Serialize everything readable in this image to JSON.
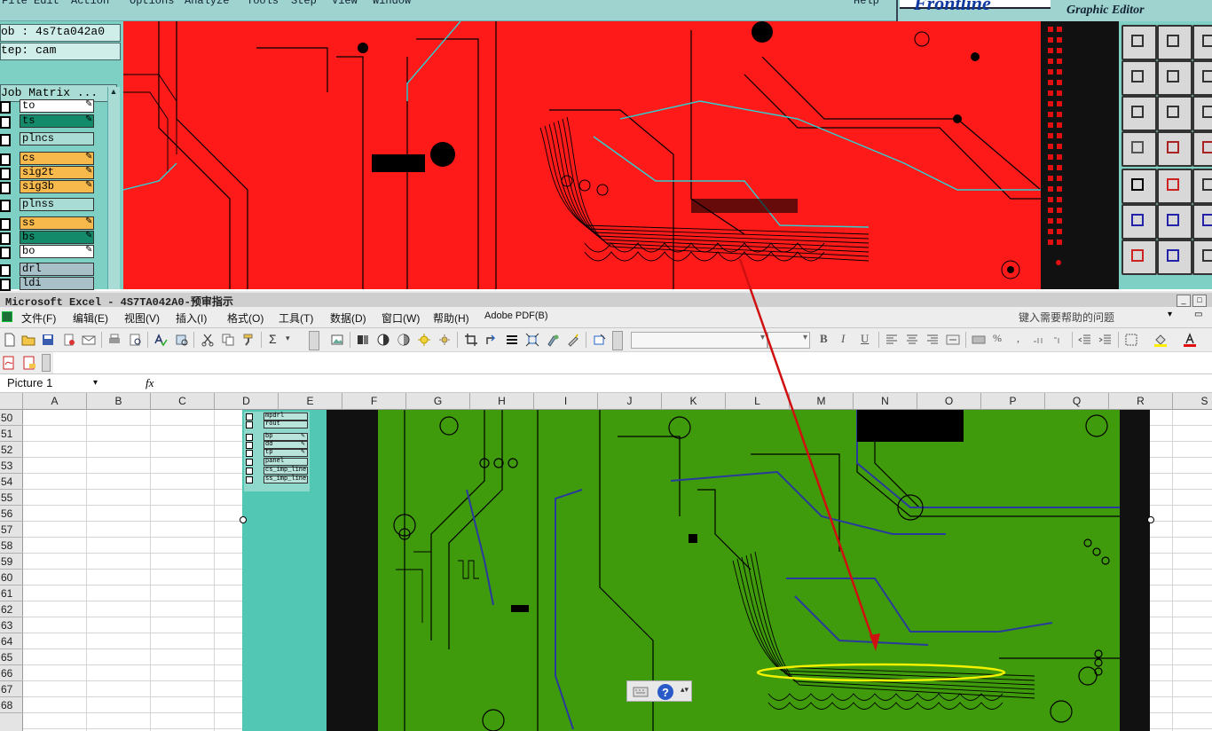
{
  "frontline": {
    "menu": [
      "File",
      "Edit",
      "Action",
      "Options",
      "Analyze",
      "Tools",
      "Step",
      "View",
      "Window",
      "Help"
    ],
    "logo": "Frontline",
    "subtitle": "Graphic Editor",
    "job": "ob : 4s7ta042a0",
    "step": "tep: cam",
    "matrix_button": "Job Matrix ...",
    "layers": [
      {
        "name": "to",
        "color": "#ffffff",
        "pen": true
      },
      {
        "name": "ts",
        "color": "#138a6a",
        "pen": true
      },
      {
        "name": "plncs",
        "color": "#a8dcd4",
        "pen": false
      },
      {
        "name": "cs",
        "color": "#f7b84c",
        "pen": true
      },
      {
        "name": "sig2t",
        "color": "#f7b84c",
        "pen": true
      },
      {
        "name": "sig3b",
        "color": "#f7b84c",
        "pen": true
      },
      {
        "name": "plnss",
        "color": "#a8dcd4",
        "pen": false
      },
      {
        "name": "ss",
        "color": "#f7b84c",
        "pen": true
      },
      {
        "name": "bs",
        "color": "#138a6a",
        "pen": true
      },
      {
        "name": "bo",
        "color": "#ffffff",
        "pen": true
      },
      {
        "name": "drl",
        "color": "#a8c0c8",
        "pen": false
      },
      {
        "name": "ldi",
        "color": "#a8c0c8",
        "pen": false
      }
    ],
    "tool_icons": [
      "copy-layer-icon",
      "paste-layer-icon",
      "home-icon",
      "pan-left-icon",
      "pan-right-icon",
      "arrow-icon",
      "zoom-fit-icon",
      "zoom-in-icon",
      "zoom-ratio-icon",
      "wrench-icon",
      "pin-icon",
      "net-icon",
      "select-icon",
      "transform-icon",
      "ruler-icon",
      "connect-icon",
      "cross-icon",
      "curve-icon",
      "measure-icon",
      "line-icon",
      "arc-icon"
    ]
  },
  "excel": {
    "title": "Microsoft Excel - 4S7TA042A0-预审指示",
    "menu": [
      "文件(F)",
      "编辑(E)",
      "视图(V)",
      "插入(I)",
      "格式(O)",
      "工具(T)",
      "数据(D)",
      "窗口(W)",
      "帮助(H)",
      "Adobe PDF(B)"
    ],
    "help_placeholder": "键入需要帮助的问题",
    "name_box": "Picture 1",
    "fx_label": "fx",
    "sum_symbol": "Σ",
    "bold": "B",
    "italic": "I",
    "underline": "U",
    "percent": "%",
    "comma": ",",
    "columns": [
      "A",
      "B",
      "C",
      "D",
      "E",
      "F",
      "G",
      "H",
      "I",
      "J",
      "K",
      "L",
      "M",
      "N",
      "O",
      "P",
      "Q",
      "R",
      "S"
    ],
    "rows": [
      "50",
      "51",
      "52",
      "53",
      "54",
      "55",
      "56",
      "57",
      "58",
      "59",
      "60",
      "61",
      "62",
      "63",
      "64",
      "65",
      "66",
      "67",
      "68"
    ],
    "picture_layers": [
      {
        "name": "mpdrl",
        "pen": false
      },
      {
        "name": "rout",
        "pen": false
      },
      {
        "name": "bp",
        "pen": true
      },
      {
        "name": "dd",
        "pen": true
      },
      {
        "name": "tp",
        "pen": true
      },
      {
        "name": "panel",
        "pen": false
      },
      {
        "name": "cs_imp_line",
        "pen": false
      },
      {
        "name": "ss_imp_line",
        "pen": false
      }
    ]
  },
  "colors": {
    "pcb_red": "#ff1a1a",
    "pcb_green": "#3f9b0b",
    "annotation_arrow": "#d01010",
    "annotation_ellipse": "#f2f200",
    "frontline_panel": "#7fd0c4"
  }
}
